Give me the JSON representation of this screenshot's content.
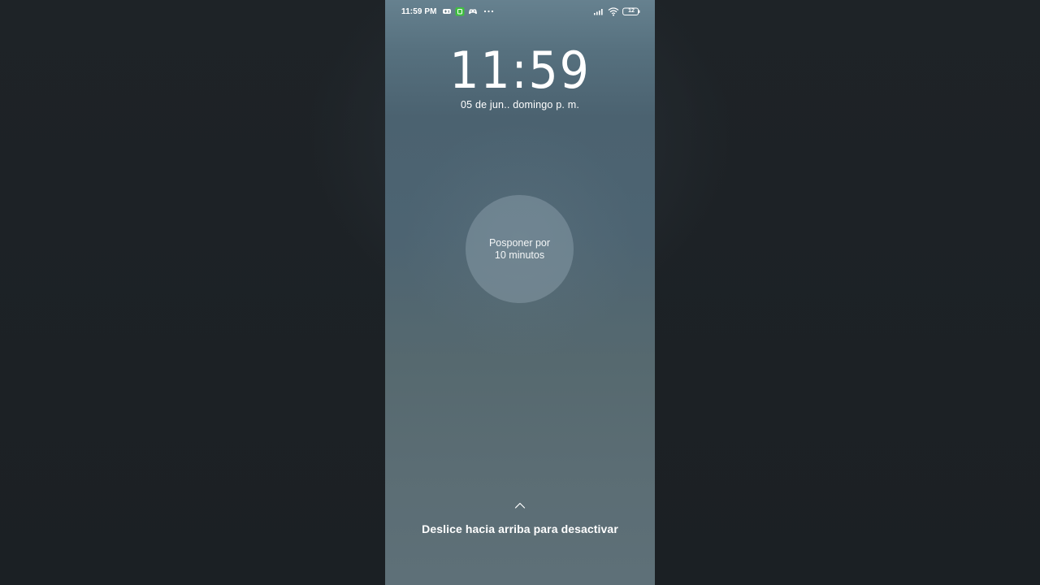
{
  "status_bar": {
    "time": "11:59 PM",
    "left_icons": [
      "gamepad-icon",
      "green-app-icon",
      "game-controller-icon",
      "more-dots-icon"
    ],
    "right_icons": [
      "signal-icon",
      "wifi-icon",
      "battery-icon"
    ],
    "battery_level": "12"
  },
  "lock_clock": {
    "time": "11:59",
    "date": "05 de jun.. domingo p. m."
  },
  "snooze": {
    "line1": "Posponer por",
    "line2": "10 minutos"
  },
  "dismiss": {
    "hint": "Deslice hacia arriba para desactivar",
    "icon": "chevron-up-icon"
  },
  "colors": {
    "backdrop": "#1c2125",
    "phone_top": "#66818f",
    "phone_bottom": "#5e7078",
    "text": "#ffffff",
    "accent_green": "#3fbf3f"
  }
}
